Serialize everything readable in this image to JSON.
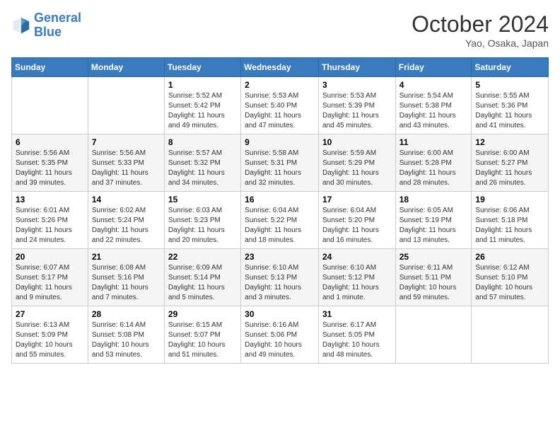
{
  "header": {
    "logo_line1": "General",
    "logo_line2": "Blue",
    "month": "October 2024",
    "location": "Yao, Osaka, Japan"
  },
  "weekdays": [
    "Sunday",
    "Monday",
    "Tuesday",
    "Wednesday",
    "Thursday",
    "Friday",
    "Saturday"
  ],
  "weeks": [
    [
      null,
      null,
      {
        "day": 1,
        "sunrise": "5:52 AM",
        "sunset": "5:42 PM",
        "daylight": "11 hours and 49 minutes."
      },
      {
        "day": 2,
        "sunrise": "5:53 AM",
        "sunset": "5:40 PM",
        "daylight": "11 hours and 47 minutes."
      },
      {
        "day": 3,
        "sunrise": "5:53 AM",
        "sunset": "5:39 PM",
        "daylight": "11 hours and 45 minutes."
      },
      {
        "day": 4,
        "sunrise": "5:54 AM",
        "sunset": "5:38 PM",
        "daylight": "11 hours and 43 minutes."
      },
      {
        "day": 5,
        "sunrise": "5:55 AM",
        "sunset": "5:36 PM",
        "daylight": "11 hours and 41 minutes."
      }
    ],
    [
      {
        "day": 6,
        "sunrise": "5:56 AM",
        "sunset": "5:35 PM",
        "daylight": "11 hours and 39 minutes."
      },
      {
        "day": 7,
        "sunrise": "5:56 AM",
        "sunset": "5:33 PM",
        "daylight": "11 hours and 37 minutes."
      },
      {
        "day": 8,
        "sunrise": "5:57 AM",
        "sunset": "5:32 PM",
        "daylight": "11 hours and 34 minutes."
      },
      {
        "day": 9,
        "sunrise": "5:58 AM",
        "sunset": "5:31 PM",
        "daylight": "11 hours and 32 minutes."
      },
      {
        "day": 10,
        "sunrise": "5:59 AM",
        "sunset": "5:29 PM",
        "daylight": "11 hours and 30 minutes."
      },
      {
        "day": 11,
        "sunrise": "6:00 AM",
        "sunset": "5:28 PM",
        "daylight": "11 hours and 28 minutes."
      },
      {
        "day": 12,
        "sunrise": "6:00 AM",
        "sunset": "5:27 PM",
        "daylight": "11 hours and 26 minutes."
      }
    ],
    [
      {
        "day": 13,
        "sunrise": "6:01 AM",
        "sunset": "5:26 PM",
        "daylight": "11 hours and 24 minutes."
      },
      {
        "day": 14,
        "sunrise": "6:02 AM",
        "sunset": "5:24 PM",
        "daylight": "11 hours and 22 minutes."
      },
      {
        "day": 15,
        "sunrise": "6:03 AM",
        "sunset": "5:23 PM",
        "daylight": "11 hours and 20 minutes."
      },
      {
        "day": 16,
        "sunrise": "6:04 AM",
        "sunset": "5:22 PM",
        "daylight": "11 hours and 18 minutes."
      },
      {
        "day": 17,
        "sunrise": "6:04 AM",
        "sunset": "5:20 PM",
        "daylight": "11 hours and 16 minutes."
      },
      {
        "day": 18,
        "sunrise": "6:05 AM",
        "sunset": "5:19 PM",
        "daylight": "11 hours and 13 minutes."
      },
      {
        "day": 19,
        "sunrise": "6:06 AM",
        "sunset": "5:18 PM",
        "daylight": "11 hours and 11 minutes."
      }
    ],
    [
      {
        "day": 20,
        "sunrise": "6:07 AM",
        "sunset": "5:17 PM",
        "daylight": "11 hours and 9 minutes."
      },
      {
        "day": 21,
        "sunrise": "6:08 AM",
        "sunset": "5:16 PM",
        "daylight": "11 hours and 7 minutes."
      },
      {
        "day": 22,
        "sunrise": "6:09 AM",
        "sunset": "5:14 PM",
        "daylight": "11 hours and 5 minutes."
      },
      {
        "day": 23,
        "sunrise": "6:10 AM",
        "sunset": "5:13 PM",
        "daylight": "11 hours and 3 minutes."
      },
      {
        "day": 24,
        "sunrise": "6:10 AM",
        "sunset": "5:12 PM",
        "daylight": "11 hours and 1 minute."
      },
      {
        "day": 25,
        "sunrise": "6:11 AM",
        "sunset": "5:11 PM",
        "daylight": "10 hours and 59 minutes."
      },
      {
        "day": 26,
        "sunrise": "6:12 AM",
        "sunset": "5:10 PM",
        "daylight": "10 hours and 57 minutes."
      }
    ],
    [
      {
        "day": 27,
        "sunrise": "6:13 AM",
        "sunset": "5:09 PM",
        "daylight": "10 hours and 55 minutes."
      },
      {
        "day": 28,
        "sunrise": "6:14 AM",
        "sunset": "5:08 PM",
        "daylight": "10 hours and 53 minutes."
      },
      {
        "day": 29,
        "sunrise": "6:15 AM",
        "sunset": "5:07 PM",
        "daylight": "10 hours and 51 minutes."
      },
      {
        "day": 30,
        "sunrise": "6:16 AM",
        "sunset": "5:06 PM",
        "daylight": "10 hours and 49 minutes."
      },
      {
        "day": 31,
        "sunrise": "6:17 AM",
        "sunset": "5:05 PM",
        "daylight": "10 hours and 48 minutes."
      },
      null,
      null
    ]
  ]
}
